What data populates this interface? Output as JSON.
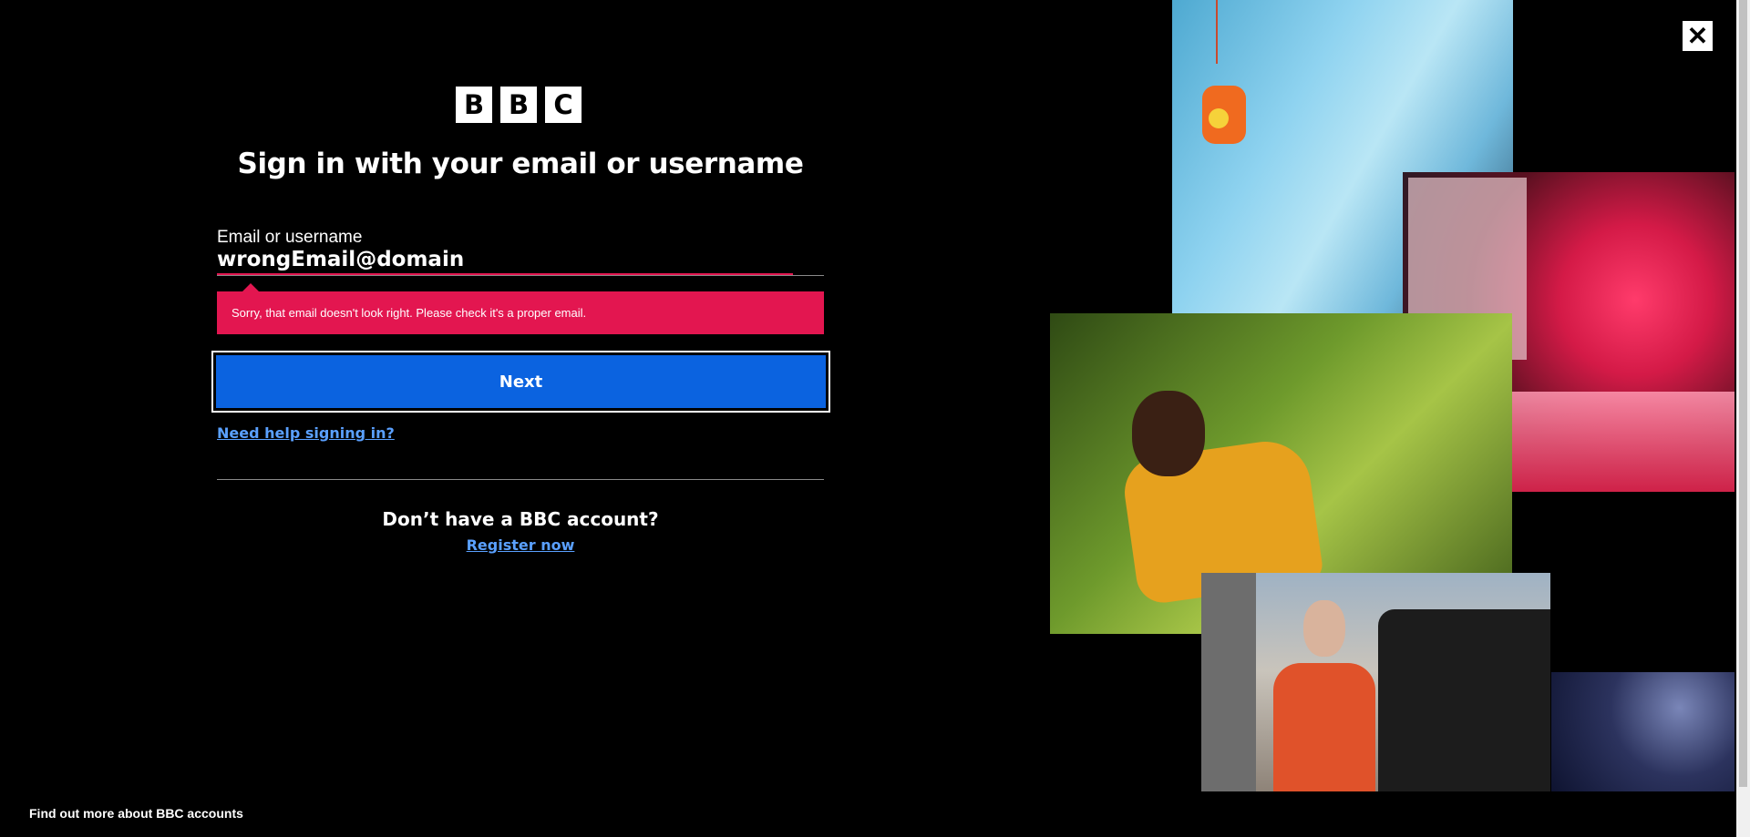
{
  "brand": {
    "letters": [
      "B",
      "B",
      "C"
    ]
  },
  "signin": {
    "title": "Sign in with your email or username",
    "field_label": "Email or username",
    "field_value": "wrongEmail@domain",
    "error_message": "Sorry, that email doesn't look right. Please check it's a proper email.",
    "next_label": "Next",
    "help_link": "Need help signing in?"
  },
  "register": {
    "prompt": "Don’t have a BBC account?",
    "link": "Register now"
  },
  "footer": {
    "link": "Find out more about BBC accounts"
  },
  "close": {
    "glyph": "✕"
  },
  "colors": {
    "background": "#000000",
    "error": "#e31650",
    "primary_button": "#0b63e0",
    "link": "#5aa0ff"
  }
}
